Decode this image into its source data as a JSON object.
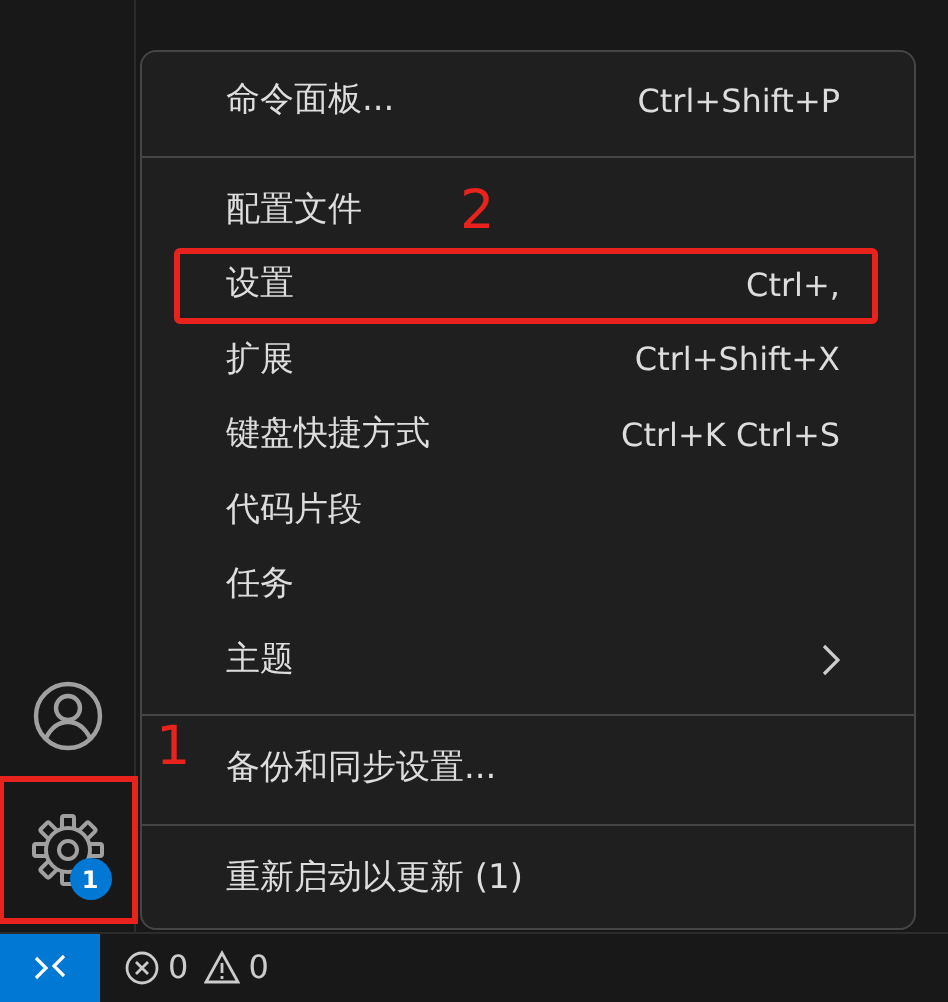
{
  "activity_bar": {
    "manage": {
      "badge": "1",
      "highlighted": true,
      "callout": "1"
    }
  },
  "menu": {
    "items": [
      {
        "kind": "item",
        "label": "命令面板...",
        "shortcut": "Ctrl+Shift+P",
        "highlighted": false
      },
      {
        "kind": "separator"
      },
      {
        "kind": "item",
        "label": "配置文件",
        "highlighted": false,
        "callout": "2"
      },
      {
        "kind": "item",
        "label": "设置",
        "shortcut": "Ctrl+,",
        "highlighted": true
      },
      {
        "kind": "item",
        "label": "扩展",
        "shortcut": "Ctrl+Shift+X",
        "highlighted": false
      },
      {
        "kind": "item",
        "label": "键盘快捷方式",
        "shortcut": "Ctrl+K Ctrl+S",
        "highlighted": false
      },
      {
        "kind": "item",
        "label": "代码片段",
        "highlighted": false
      },
      {
        "kind": "item",
        "label": "任务",
        "highlighted": false
      },
      {
        "kind": "submenu",
        "label": "主题",
        "highlighted": false
      },
      {
        "kind": "separator"
      },
      {
        "kind": "item",
        "label": "备份和同步设置...",
        "highlighted": false
      },
      {
        "kind": "separator"
      },
      {
        "kind": "item",
        "label": "重新启动以更新 (1)",
        "highlighted": false
      }
    ]
  },
  "status_bar": {
    "errors": "0",
    "warnings": "0"
  }
}
